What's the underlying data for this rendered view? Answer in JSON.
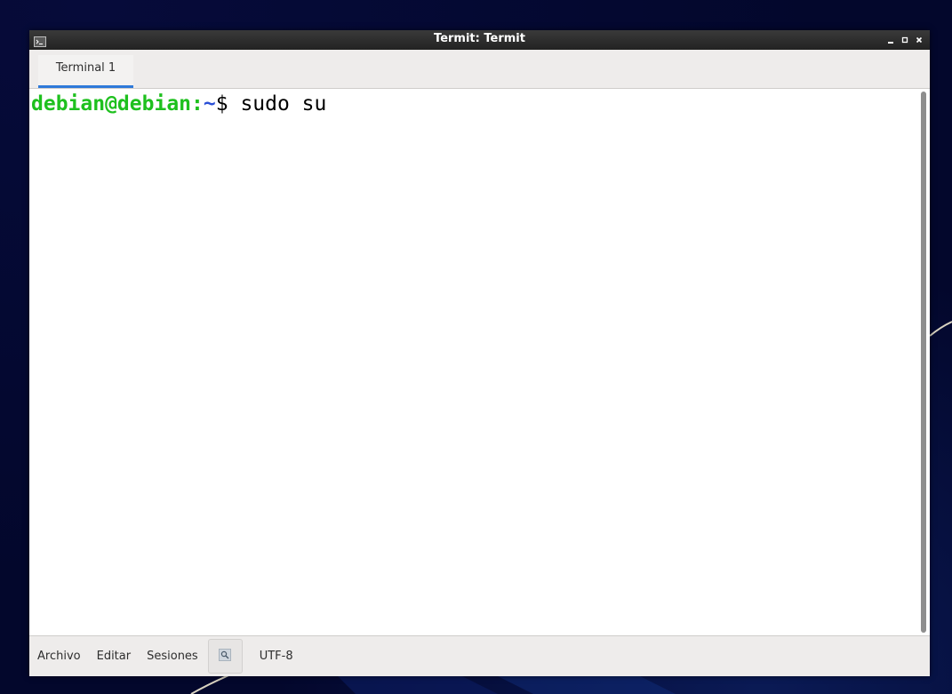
{
  "window": {
    "title": "Termit: Termit",
    "controls": [
      "minimize-icon",
      "maximize-icon",
      "close-icon"
    ]
  },
  "tabs": [
    {
      "label": "Terminal 1",
      "active": true
    }
  ],
  "terminal": {
    "prompt_user": "debian@debian",
    "prompt_colon": ":",
    "prompt_path": "~",
    "prompt_symbol": "$ ",
    "command": "sudo su"
  },
  "statusbar": {
    "menu": [
      "Archivo",
      "Editar",
      "Sesiones"
    ],
    "search_icon": "search-icon",
    "encoding": "UTF-8"
  },
  "colors": {
    "prompt_user": "#1ec01e",
    "prompt_path": "#2a4fd6",
    "tab_accent": "#2f7ad9",
    "titlebar": "#2b2b2b",
    "desktop": "#03072c"
  }
}
